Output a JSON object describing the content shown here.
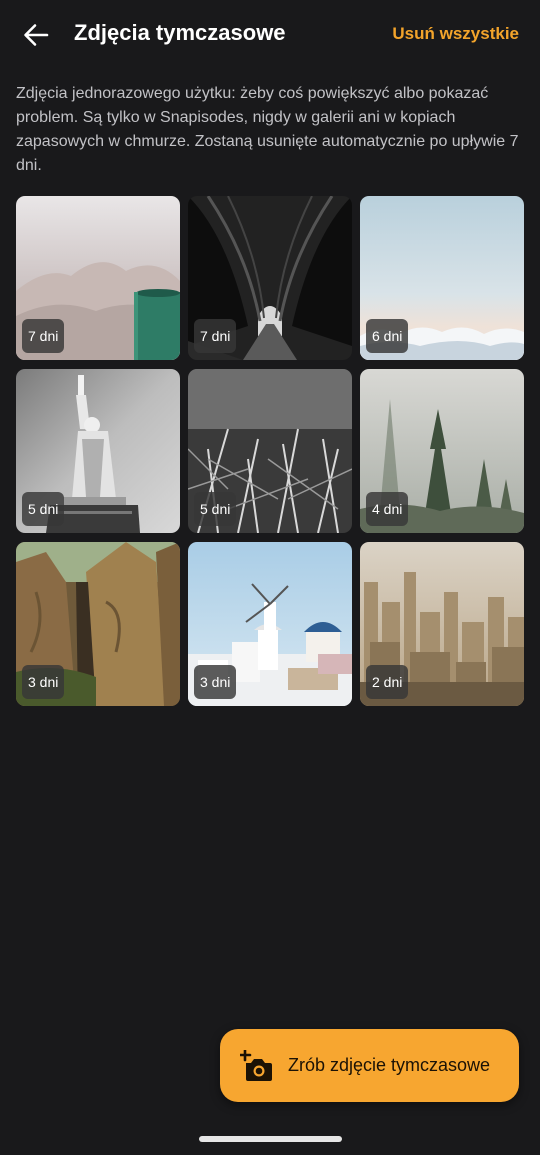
{
  "header": {
    "title": "Zdjęcia tymczasowe",
    "delete_all_label": "Usuń wszystkie",
    "back_icon": "arrow-left-icon"
  },
  "description": "Zdjęcia jednorazowego użytku: żeby coś powiększyć albo pokazać problem. Są tylko w Snapisodes, nigdy w galerii ani w kopiach zapasowych w chmurze. Zostaną usunięte automatycznie po upływie 7 dni.",
  "photos": [
    {
      "badge": "7 dni",
      "subject": "mug-in-mist"
    },
    {
      "badge": "7 dni",
      "subject": "tree-tunnel-road"
    },
    {
      "badge": "6 dni",
      "subject": "sky-above-clouds"
    },
    {
      "badge": "5 dni",
      "subject": "statue-of-liberty"
    },
    {
      "badge": "5 dni",
      "subject": "grass-closeup"
    },
    {
      "badge": "4 dni",
      "subject": "foggy-pines"
    },
    {
      "badge": "3 dni",
      "subject": "sandstone-rocks"
    },
    {
      "badge": "3 dni",
      "subject": "santorini-windmill"
    },
    {
      "badge": "2 dni",
      "subject": "hazy-city"
    }
  ],
  "fab": {
    "label": "Zrób zdjęcie tymczasowe",
    "icon": "camera-plus-icon"
  },
  "colors": {
    "background": "#19191b",
    "accent": "#f7a630",
    "accent_text": "#f3a42b"
  }
}
